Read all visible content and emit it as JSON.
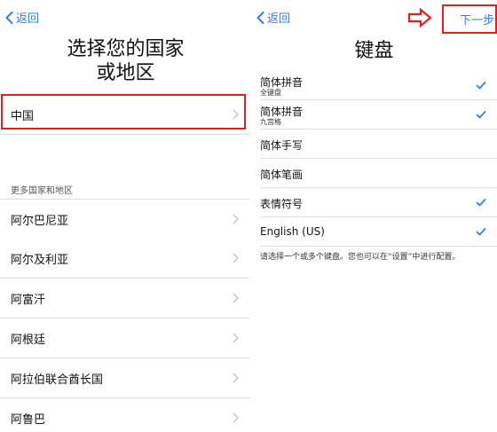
{
  "left": {
    "back_label": "返回",
    "title_line1": "选择您的国家",
    "title_line2": "或地区",
    "selected_country": "中国",
    "section_header": "更多国家和地区",
    "countries": [
      {
        "label": "阿尔巴尼亚"
      },
      {
        "label": "阿尔及利亚"
      },
      {
        "label": "阿富汗"
      },
      {
        "label": "阿根廷"
      },
      {
        "label": "阿拉伯联合酋长国"
      },
      {
        "label": "阿鲁巴"
      }
    ]
  },
  "right": {
    "back_label": "返回",
    "next_label": "下一步",
    "title": "键盘",
    "keyboards": [
      {
        "label": "简体拼音",
        "sublabel": "全键盘",
        "checked": true
      },
      {
        "label": "简体拼音",
        "sublabel": "九宫格",
        "checked": true
      },
      {
        "label": "简体手写",
        "sublabel": "",
        "checked": false
      },
      {
        "label": "简体笔画",
        "sublabel": "",
        "checked": false
      },
      {
        "label": "表情符号",
        "sublabel": "",
        "checked": true
      },
      {
        "label": "English (US)",
        "sublabel": "",
        "checked": true
      }
    ],
    "footnote": "请选择一个或多个键盘。您也可以在“设置”中进行配置。"
  },
  "colors": {
    "accent": "#2f7cf6",
    "highlight": "#e02020",
    "separator": "#dcdcdc"
  },
  "icons": {
    "back": "chevron-left-icon",
    "row": "chevron-right-icon",
    "check": "checkmark-icon",
    "pointer": "arrow-right-icon"
  }
}
